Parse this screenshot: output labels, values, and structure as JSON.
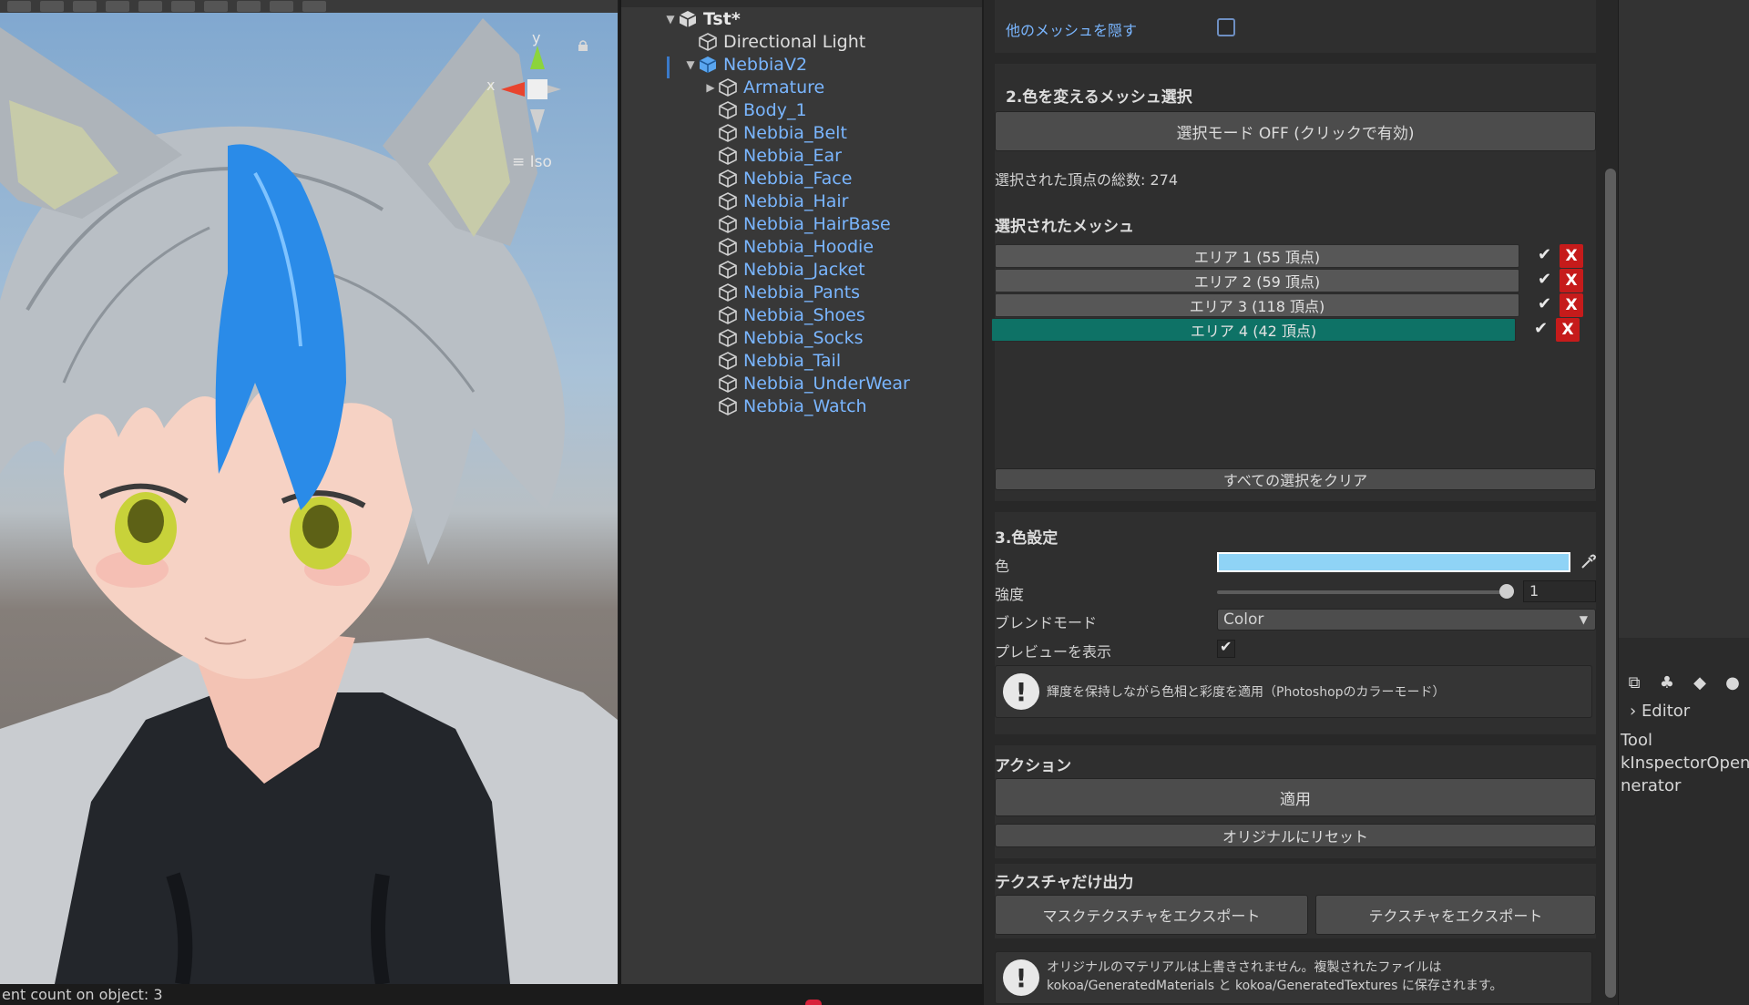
{
  "scene": {
    "gizmo": {
      "y_label": "y",
      "x_label": "x",
      "projection": "Iso"
    },
    "icons": [
      "lock-icon"
    ]
  },
  "hierarchy": {
    "scene_name": "Tst*",
    "items": [
      {
        "label": "Directional Light",
        "depth": 1,
        "expand": "",
        "color": "white"
      },
      {
        "label": "NebbiaV2",
        "depth": 1,
        "expand": "▼",
        "color": "blue"
      },
      {
        "label": "Armature",
        "depth": 2,
        "expand": "▶",
        "color": "blue"
      },
      {
        "label": "Body_1",
        "depth": 2,
        "expand": "",
        "color": "blue"
      },
      {
        "label": "Nebbia_Belt",
        "depth": 2,
        "expand": "",
        "color": "blue"
      },
      {
        "label": "Nebbia_Ear",
        "depth": 2,
        "expand": "",
        "color": "blue"
      },
      {
        "label": "Nebbia_Face",
        "depth": 2,
        "expand": "",
        "color": "blue"
      },
      {
        "label": "Nebbia_Hair",
        "depth": 2,
        "expand": "",
        "color": "blue"
      },
      {
        "label": "Nebbia_HairBase",
        "depth": 2,
        "expand": "",
        "color": "blue"
      },
      {
        "label": "Nebbia_Hoodie",
        "depth": 2,
        "expand": "",
        "color": "blue"
      },
      {
        "label": "Nebbia_Jacket",
        "depth": 2,
        "expand": "",
        "color": "blue"
      },
      {
        "label": "Nebbia_Pants",
        "depth": 2,
        "expand": "",
        "color": "blue"
      },
      {
        "label": "Nebbia_Shoes",
        "depth": 2,
        "expand": "",
        "color": "blue"
      },
      {
        "label": "Nebbia_Socks",
        "depth": 2,
        "expand": "",
        "color": "blue"
      },
      {
        "label": "Nebbia_Tail",
        "depth": 2,
        "expand": "",
        "color": "blue"
      },
      {
        "label": "Nebbia_UnderWear",
        "depth": 2,
        "expand": "",
        "color": "blue"
      },
      {
        "label": "Nebbia_Watch",
        "depth": 2,
        "expand": "",
        "color": "blue"
      }
    ]
  },
  "inspector": {
    "hide_other_meshes_label": "他のメッシュを隠す",
    "section2_title": "2.色を変えるメッシュ選択",
    "selection_mode_button": "選択モード OFF (クリックで有効)",
    "total_vertices": "選択された頂点の総数: 274",
    "selected_meshes_title": "選択されたメッシュ",
    "areas": [
      {
        "label": "エリア 1 (55 頂点)",
        "checked": true,
        "selected": false
      },
      {
        "label": "エリア 2 (59 頂点)",
        "checked": true,
        "selected": false
      },
      {
        "label": "エリア 3 (118 頂点)",
        "checked": true,
        "selected": false
      },
      {
        "label": "エリア 4 (42 頂点)",
        "checked": true,
        "selected": true
      }
    ],
    "check_glyph": "✔",
    "delete_glyph": "X",
    "clear_all_button": "すべての選択をクリア",
    "section3_title": "3.色設定",
    "color_label": "色",
    "color_value": "#8fd3f6",
    "intensity_label": "強度",
    "intensity_value": "1",
    "intensity_fraction": 0.98,
    "blend_mode_label": "ブレンドモード",
    "blend_mode_value": "Color",
    "preview_label": "プレビューを表示",
    "blend_info": "輝度を保持しながら色相と彩度を適用（Photoshopのカラーモード）",
    "actions_title": "アクション",
    "apply_button": "適用",
    "reset_button": "オリジナルにリセット",
    "texture_export_title": "テクスチャだけ出力",
    "export_mask_button": "マスクテクスチャをエクスポート",
    "export_texture_button": "テクスチャをエクスポート",
    "footer_info_line1": "オリジナルのマテリアルは上書きされません。複製されたファイルは",
    "footer_info_line2": "kokoa/GeneratedMaterials と kokoa/GeneratedTextures に保存されます。",
    "info_glyph": "!"
  },
  "right_panel": {
    "folder_label": "Editor",
    "lines": [
      "Tool",
      "kInspectorOpene",
      "nerator"
    ]
  },
  "status_bar": {
    "text": "ent count on object: 3"
  },
  "colors": {
    "accent_blue": "#7ab6ff",
    "selected_teal": "#0e7266",
    "delete_red": "#c61b1b"
  }
}
